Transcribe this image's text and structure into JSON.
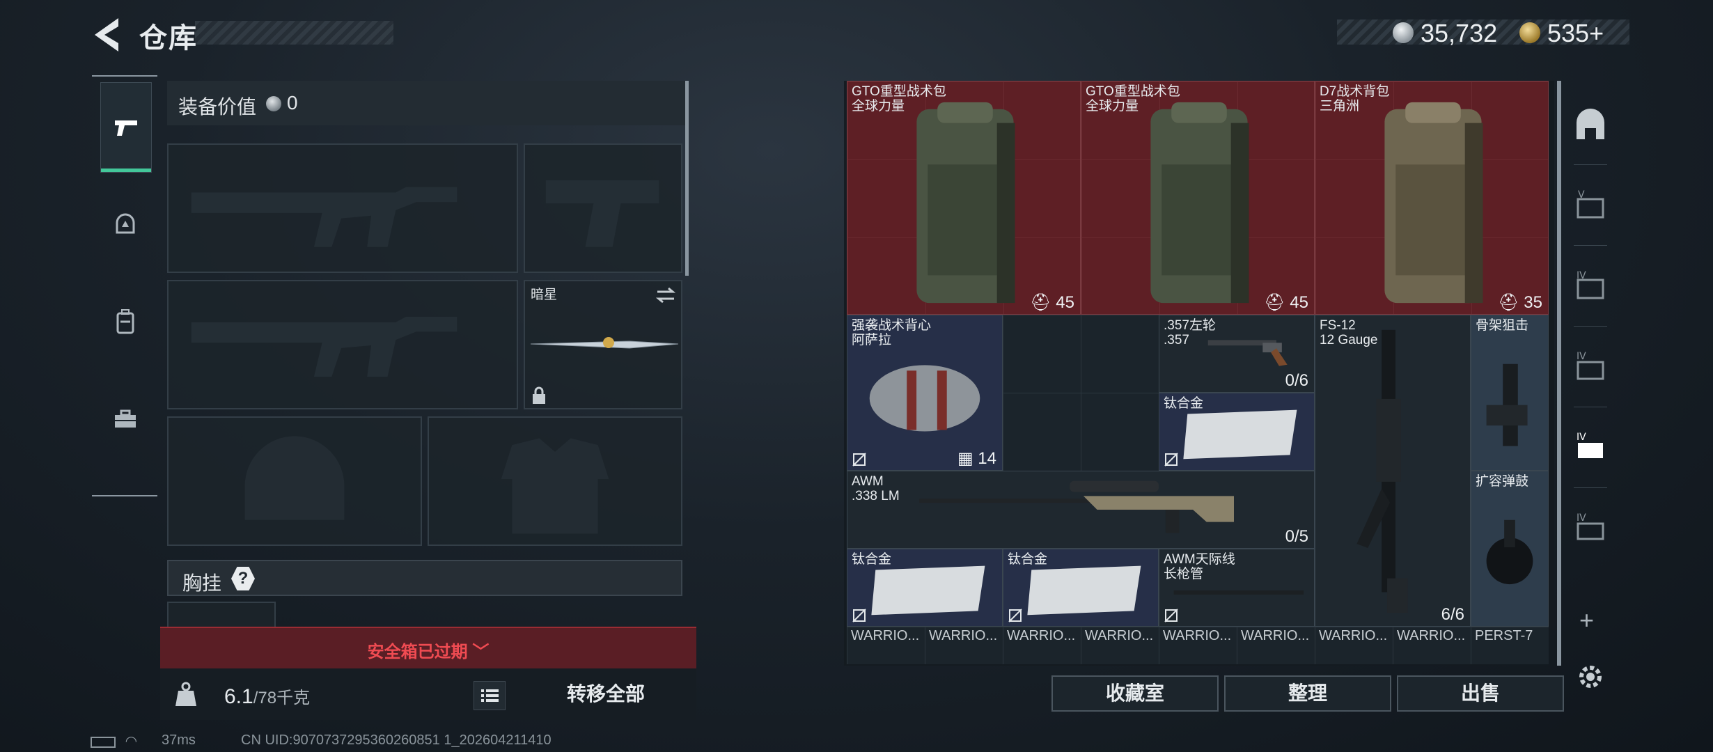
{
  "header": {
    "title": "仓库"
  },
  "currency": {
    "silver": "35,732",
    "gold": "535",
    "gold_add": "+"
  },
  "left_panel": {
    "equip_value_label": "装备价值",
    "equip_value": "0",
    "melee_slot_name": "暗星",
    "chest_label": "胸挂",
    "chest_help": "?",
    "safebox_text": "安全箱已过期",
    "weight_current": "6.1",
    "weight_max": "/78千克",
    "transfer_all": "转移全部"
  },
  "stash_items": [
    {
      "name": "GTO重型战术包\n全球力量",
      "count": "45"
    },
    {
      "name": "GTO重型战术包\n全球力量",
      "count": "45"
    },
    {
      "name": "D7战术背包\n三角洲",
      "count": "35"
    },
    {
      "name": "强袭战术背心\n阿萨拉",
      "count": "14"
    },
    {
      "name": ".357左轮\n.357",
      "count": "0/6"
    },
    {
      "name": "FS-12\n12 Gauge",
      "count": "6/6"
    },
    {
      "name": "骨架狙击",
      "count": ""
    },
    {
      "name": "钛合金",
      "count": ""
    },
    {
      "name": "AWM\n.338 LM",
      "count": "0/5"
    },
    {
      "name": "扩容弹鼓",
      "count": ""
    },
    {
      "name": "钛合金",
      "count": ""
    },
    {
      "name": "钛合金",
      "count": ""
    },
    {
      "name": "AWM天际线\n长枪管",
      "count": ""
    }
  ],
  "stash_bottom_row": [
    "WARRIO...",
    "WARRIO...",
    "WARRIO...",
    "WARRIO...",
    "WARRIO...",
    "WARRIO...",
    "WARRIO...",
    "WARRIO...",
    "PERST-7"
  ],
  "stash_buttons": {
    "collection": "收藏室",
    "organize": "整理",
    "sell": "出售"
  },
  "right_tabs": {
    "plus": "+"
  },
  "status": {
    "ping": "37ms",
    "uid": "CN UID:9070737295360260851 1_202604211410"
  },
  "colors": {
    "accent": "#43c79a",
    "danger": "#f04b52",
    "rarity_red": "#5e1f25",
    "rarity_blue": "#262f48"
  },
  "icons": [
    "back-arrow-icon",
    "silver-coin-icon",
    "gold-coin-icon",
    "pistol-icon",
    "helmet-icon",
    "backpack-icon",
    "toolbox-icon",
    "weight-icon",
    "list-icon",
    "lock-icon",
    "swap-icon",
    "gear-icon",
    "plus-icon",
    "battery-icon",
    "wifi-icon"
  ]
}
